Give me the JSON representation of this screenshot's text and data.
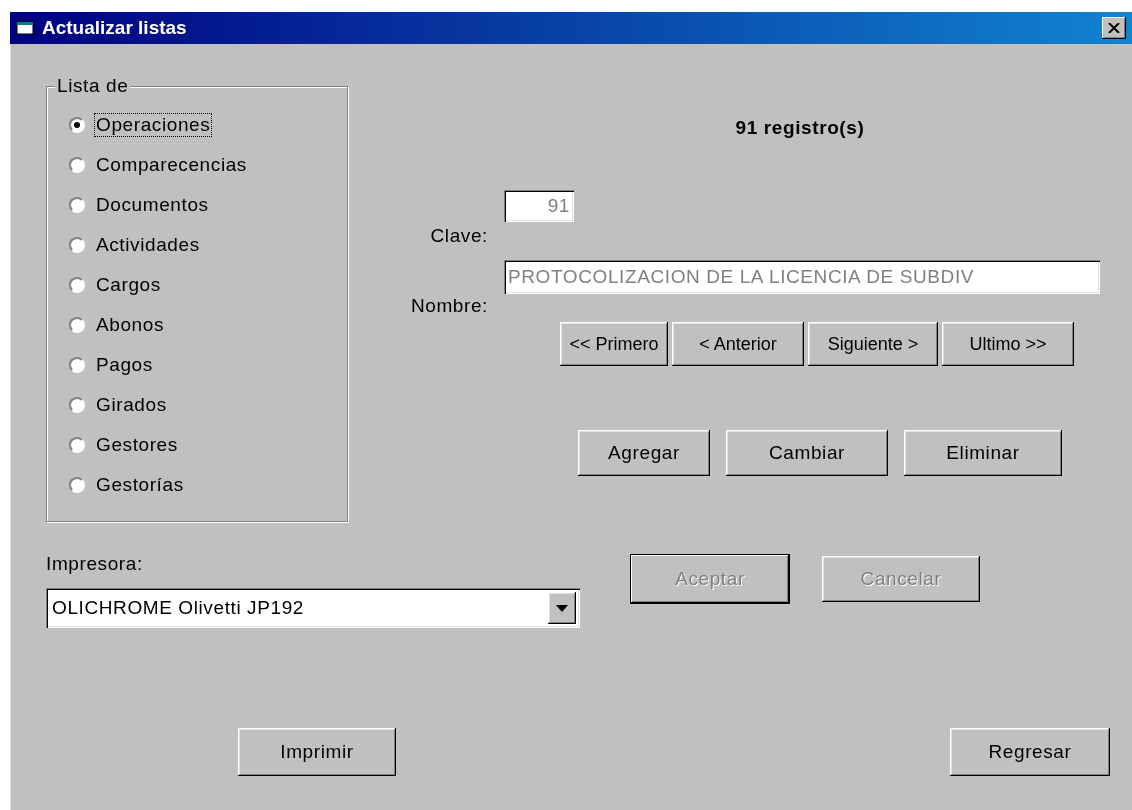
{
  "window": {
    "title": "Actualizar listas"
  },
  "list_group": {
    "label": "Lista de",
    "options": [
      {
        "label": "Operaciones",
        "selected": true
      },
      {
        "label": "Comparecencias",
        "selected": false
      },
      {
        "label": "Documentos",
        "selected": false
      },
      {
        "label": "Actividades",
        "selected": false
      },
      {
        "label": "Cargos",
        "selected": false
      },
      {
        "label": "Abonos",
        "selected": false
      },
      {
        "label": "Pagos",
        "selected": false
      },
      {
        "label": "Girados",
        "selected": false
      },
      {
        "label": "Gestores",
        "selected": false
      },
      {
        "label": "Gestorías",
        "selected": false
      }
    ]
  },
  "record_count": "91 registro(s)",
  "fields": [
    {
      "label": "Clave:",
      "value": "91",
      "kind": "short",
      "disabled": true
    },
    {
      "label": "Nombre:",
      "value": "PROTOCOLIZACION DE LA LICENCIA DE SUBDIV",
      "kind": "long",
      "disabled": true
    }
  ],
  "navigation_buttons": [
    "<< Primero",
    "<  Anterior",
    "Siguiente >",
    "Ultimo >>"
  ],
  "action_buttons": [
    "Agregar",
    "Cambiar",
    "Eliminar"
  ],
  "printer": {
    "label": "Impresora:",
    "value": "OLICHROME Olivetti JP192"
  },
  "confirm_buttons": [
    {
      "label": "Aceptar",
      "disabled": true,
      "default": true
    },
    {
      "label": "Cancelar",
      "disabled": true,
      "default": false
    }
  ],
  "footer_buttons": [
    "Imprimir",
    "Regresar"
  ]
}
